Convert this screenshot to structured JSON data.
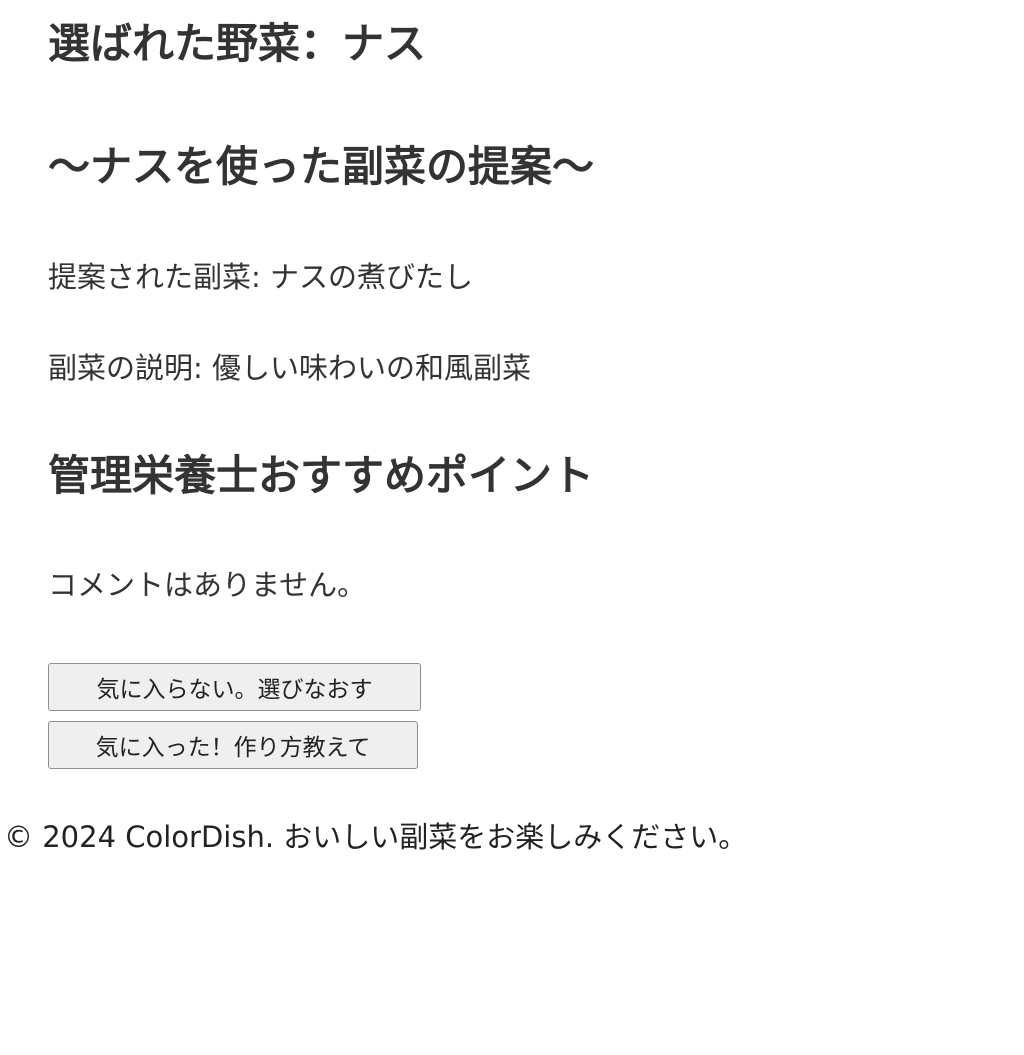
{
  "selected": {
    "heading": "選ばれた野菜：ナス"
  },
  "proposal": {
    "heading": "〜ナスを使った副菜の提案〜",
    "dish_line": "提案された副菜: ナスの煮びたし",
    "description_line": "副菜の説明: 優しい味わいの和風副菜"
  },
  "points": {
    "heading": "管理栄養士おすすめポイント",
    "comment": "コメントはありません。"
  },
  "actions": {
    "dislike_label": "気に入らない。選びなおす",
    "like_label": "気に入った！作り方教えて"
  },
  "footer": {
    "text": "© 2024 ColorDish. おいしい副菜をお楽しみください。"
  }
}
